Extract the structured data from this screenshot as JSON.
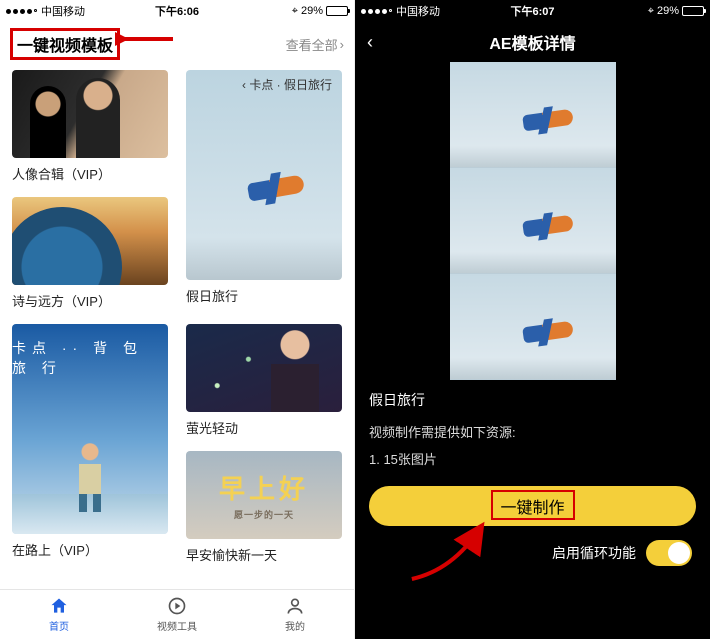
{
  "left": {
    "status": {
      "carrier": "中国移动",
      "time": "下午6:06",
      "battery": "29%"
    },
    "section_title": "一键视频模板",
    "view_all": "查看全部",
    "overlay_card2": "‹ 卡点 · 假日旅行",
    "overlay_card5": "卡点 ·· 背 包 旅 行",
    "overlay_morning": "早上好",
    "overlay_morning_sub": "愿一步的一天",
    "cards": [
      {
        "title": "人像合辑（VIP）"
      },
      {
        "title": ""
      },
      {
        "title": "诗与远方（VIP）"
      },
      {
        "title": "假日旅行"
      },
      {
        "title": "在路上（VIP）"
      },
      {
        "title": "萤光轻动"
      },
      {
        "title": ""
      },
      {
        "title": "早安愉快新一天"
      }
    ],
    "tabs": {
      "home": "首页",
      "tools": "视频工具",
      "mine": "我的"
    }
  },
  "right": {
    "status": {
      "carrier": "中国移动",
      "time": "下午6:07",
      "battery": "29%"
    },
    "nav_title": "AE模板详情",
    "detail_title": "假日旅行",
    "detail_sub": "视频制作需提供如下资源:",
    "detail_item1": "1. 15张图片",
    "make_btn": "一键制作",
    "loop_label": "启用循环功能"
  }
}
